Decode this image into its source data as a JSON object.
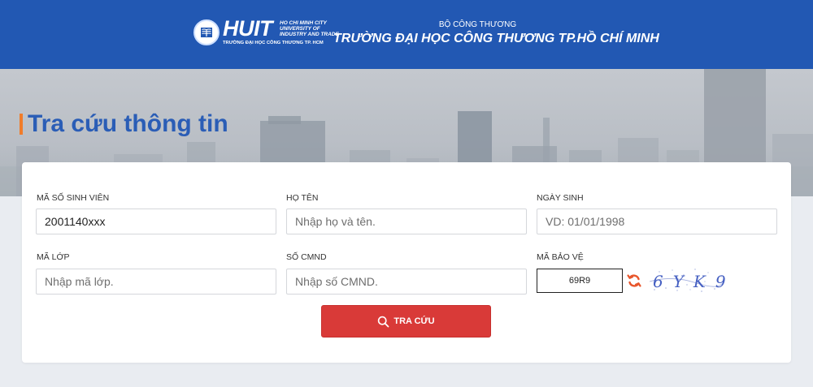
{
  "header": {
    "logo_name": "HUIT",
    "logo_side_lines": [
      "HO CHI MINH CITY",
      "UNIVERSITY OF",
      "INDUSTRY AND TRADE"
    ],
    "logo_subtitle": "TRƯỜNG ĐẠI HỌC CÔNG THƯƠNG TP. HCM",
    "ministry": "BỘ CÔNG THƯƠNG",
    "university": "TRƯỜNG ĐẠI HỌC CÔNG THƯƠNG TP.HỒ CHÍ MINH"
  },
  "page_title": "Tra cứu thông tin",
  "form": {
    "student_id": {
      "label": "MÃ SỐ SINH VIÊN",
      "value": "2001140xxx",
      "placeholder": ""
    },
    "full_name": {
      "label": "HỌ TÊN",
      "value": "",
      "placeholder": "Nhập họ và tên."
    },
    "dob": {
      "label": "NGÀY SINH",
      "value": "",
      "placeholder": "VD: 01/01/1998"
    },
    "class_code": {
      "label": "MÃ LỚP",
      "value": "",
      "placeholder": "Nhập mã lớp."
    },
    "id_card": {
      "label": "SỐ CMND",
      "value": "",
      "placeholder": "Nhập số CMND."
    },
    "captcha": {
      "label": "MÃ BẢO VỆ",
      "value": "69R9",
      "image_text": "6YK9"
    },
    "submit_label": "TRA CỨU"
  },
  "colors": {
    "header_bg": "#2258b3",
    "title": "#2a5db6",
    "accent": "#f07c2a",
    "button": "#d93a38"
  },
  "icons": [
    "logo-book-icon",
    "search-icon",
    "refresh-icon"
  ]
}
